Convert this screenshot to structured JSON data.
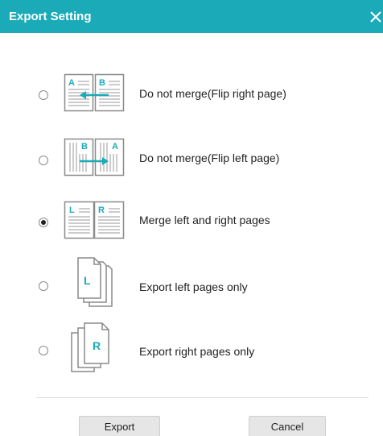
{
  "dialog": {
    "title": "Export Setting",
    "close_icon": "close-icon"
  },
  "options": [
    {
      "label": "Do not merge(Flip right page)",
      "icon": "flip-right-page-icon",
      "selected": false
    },
    {
      "label": "Do not merge(Flip left page)",
      "icon": "flip-left-page-icon",
      "selected": false
    },
    {
      "label": "Merge left and right pages",
      "icon": "merge-pages-icon",
      "selected": true
    },
    {
      "label": "Export left pages only",
      "icon": "left-pages-icon",
      "icon_letter": "L",
      "selected": false
    },
    {
      "label": "Export right pages only",
      "icon": "right-pages-icon",
      "icon_letter": "R",
      "selected": false
    }
  ],
  "icon_letters": {
    "left": "L",
    "right": "R",
    "a": "A",
    "b": "B"
  },
  "buttons": {
    "export": "Export",
    "cancel": "Cancel"
  },
  "colors": {
    "title_bar": "#1aaab8",
    "accent": "#1aaab8",
    "icon_gray": "#8a8a8a"
  }
}
